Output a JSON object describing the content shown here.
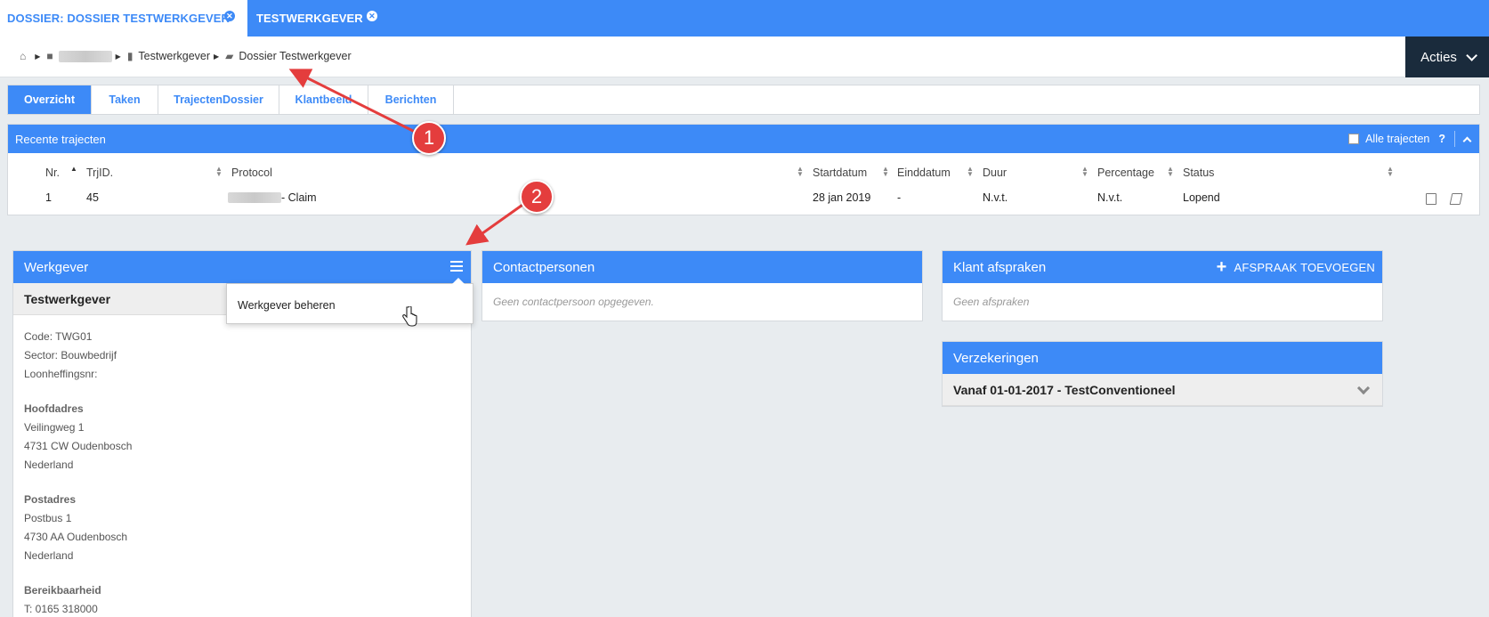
{
  "top_tabs": [
    {
      "label": "DOSSIER: DOSSIER TESTWERKGEVER",
      "close": "✕"
    },
    {
      "label": "TESTWERKGEVER",
      "close": "✕"
    }
  ],
  "breadcrumb": {
    "items": [
      "Testwerkgever",
      "Dossier Testwerkgever"
    ]
  },
  "acties": {
    "label": "Acties"
  },
  "sub_tabs": [
    "Overzicht",
    "Taken",
    "TrajectenDossier",
    "Klantbeeld",
    "Berichten"
  ],
  "recente": {
    "title": "Recente trajecten",
    "alle_label": "Alle trajecten",
    "help": "?",
    "columns": [
      "Nr.",
      "TrjID.",
      "Protocol",
      "Startdatum",
      "Einddatum",
      "Duur",
      "Percentage",
      "Status"
    ],
    "row": {
      "nr": "1",
      "trjid": "45",
      "protocol": "- Claim",
      "start": "28 jan 2019",
      "eind": "-",
      "duur": "N.v.t.",
      "percentage": "N.v.t.",
      "status": "Lopend"
    }
  },
  "werkgever": {
    "title": "Werkgever",
    "name": "Testwerkgever",
    "menu_item": "Werkgever beheren",
    "code": "Code: TWG01",
    "sector": "Sector: Bouwbedrijf",
    "loon": "Loonheffingsnr:",
    "hoofdadres_label": "Hoofdadres",
    "hoofdadres": [
      "Veilingweg 1",
      "4731 CW Oudenbosch",
      "Nederland"
    ],
    "postadres_label": "Postadres",
    "postadres": [
      "Postbus 1",
      "4730 AA Oudenbosch",
      "Nederland"
    ],
    "bereik_label": "Bereikbaarheid",
    "phone": "T: 0165 318000"
  },
  "contact": {
    "title": "Contactpersonen",
    "empty": "Geen contactpersoon opgegeven."
  },
  "klant": {
    "title": "Klant afspraken",
    "add": "AFSPRAAK TOEVOEGEN",
    "add_icon": "+",
    "empty": "Geen afspraken"
  },
  "verz": {
    "title": "Verzekeringen",
    "item": "Vanaf 01-01-2017 - TestConventioneel"
  },
  "annotations": {
    "one": "1",
    "two": "2"
  },
  "colors": {
    "accent": "#3d8af7",
    "dark": "#1a2b3c",
    "annotation": "#e43d3d"
  }
}
